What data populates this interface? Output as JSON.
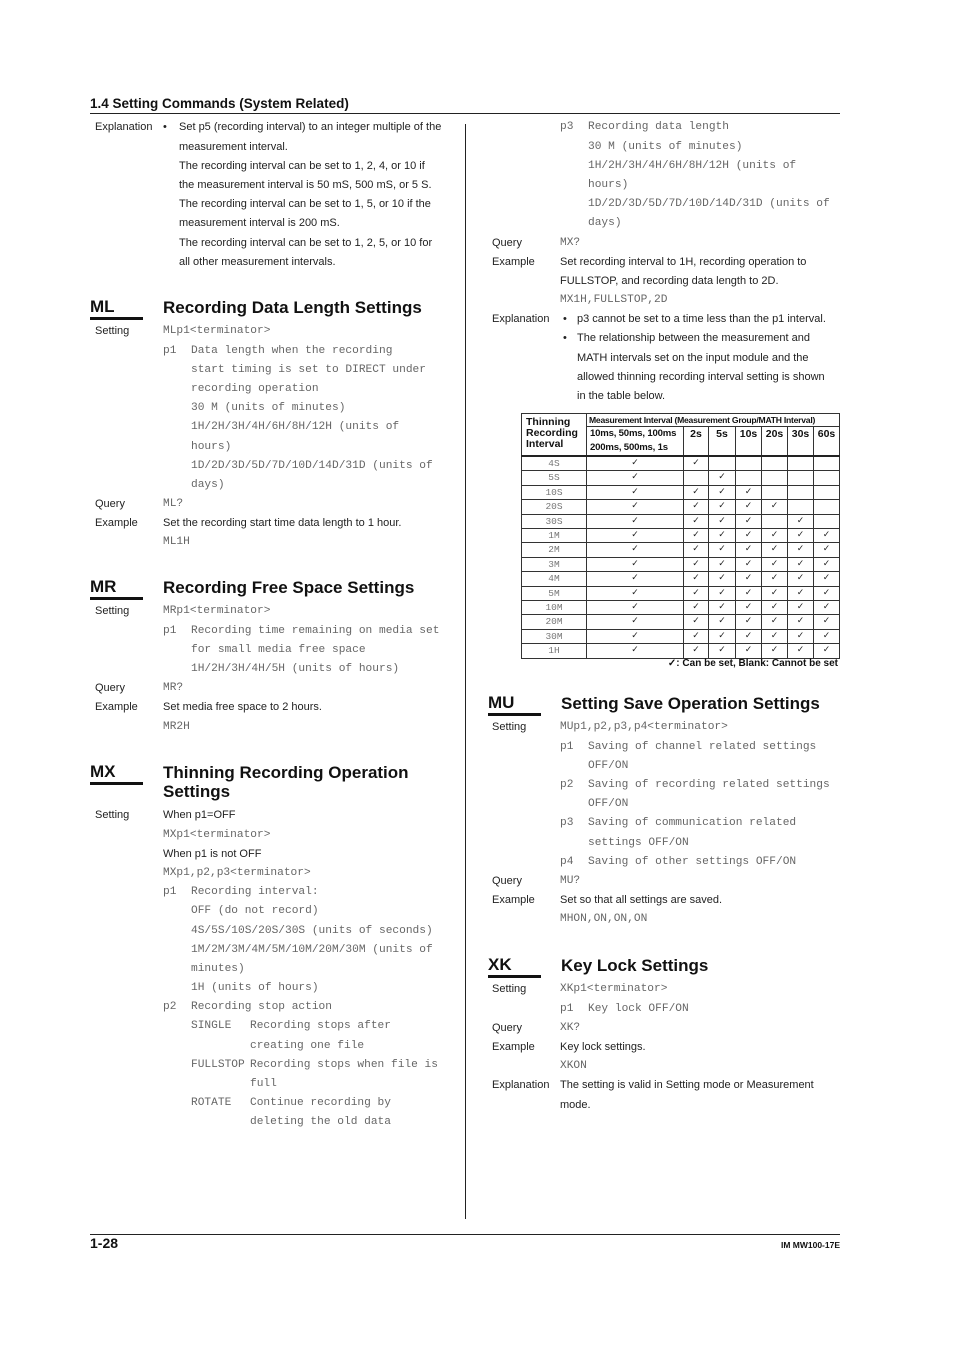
{
  "page_header": {
    "title": "1.4  Setting Commands (System Related)"
  },
  "intro_explanation": {
    "label": "Explanation",
    "bullet": "•",
    "lines": [
      "Set p5 (recording interval) to an integer multiple of the",
      "measurement interval.",
      "The recording interval can be set to 1, 2, 4, or 10 if",
      "the measurement interval is 50 mS, 500 mS, or 5 S.",
      "The recording interval can be set to 1, 5, or 10 if the",
      "measurement interval is 200 mS.",
      "The recording interval can be set to 1, 2, 5, or 10 for",
      "all other measurement intervals."
    ]
  },
  "ml": {
    "code": "ML",
    "title": "Recording Data Length Settings",
    "setting_label": "Setting",
    "syntax": "MLp1<terminator>",
    "p1": {
      "name": "p1",
      "lines": [
        "Data length when the recording",
        "start timing is set to DIRECT under",
        "recording operation",
        "30 M (units of minutes)",
        "1H/2H/3H/4H/6H/8H/12H (units of",
        "hours)",
        "1D/2D/3D/5D/7D/10D/14D/31D (units of",
        "days)"
      ]
    },
    "query_label": "Query",
    "query": "ML?",
    "example_label": "Example",
    "example_text": "Set the recording start time data length to 1 hour.",
    "example_code": "ML1H"
  },
  "mr": {
    "code": "MR",
    "title": "Recording Free Space Settings",
    "setting_label": "Setting",
    "syntax": "MRp1<terminator>",
    "p1": {
      "name": "p1",
      "lines": [
        "Recording time remaining on media set",
        "for small media free space",
        "1H/2H/3H/4H/5H (units of hours)"
      ]
    },
    "query_label": "Query",
    "query": "MR?",
    "example_label": "Example",
    "example_text": "Set media free space to 2 hours.",
    "example_code": "MR2H"
  },
  "mx": {
    "code": "MX",
    "title_lines": [
      "Thinning Recording Operation",
      "Settings"
    ],
    "setting_label": "Setting",
    "case_off_label": "When p1=OFF",
    "case_off_syntax": "MXp1<terminator>",
    "case_on_label": "When p1 is not OFF",
    "case_on_syntax": "MXp1,p2,p3<terminator>",
    "p1": {
      "name": "p1",
      "lines": [
        "Recording interval:",
        "OFF (do not record)",
        "4S/5S/10S/20S/30S (units of seconds)",
        "1M/2M/3M/4M/5M/10M/20M/30M (units of",
        "minutes)",
        "1H (units of hours)"
      ]
    },
    "p2": {
      "name": "p2",
      "title": "Recording stop action",
      "options": [
        {
          "name": "SINGLE",
          "lines": [
            "Recording stops after",
            "creating one file"
          ]
        },
        {
          "name": "FULLSTOP",
          "lines": [
            "Recording stops when file is",
            "full"
          ]
        },
        {
          "name": "ROTATE",
          "lines": [
            "Continue recording by",
            "deleting the old data"
          ]
        }
      ]
    },
    "p3": {
      "name": "p3",
      "lines": [
        "Recording data length",
        "30 M (units of minutes)",
        "1H/2H/3H/4H/6H/8H/12H (units of",
        "hours)",
        "1D/2D/3D/5D/7D/10D/14D/31D (units of",
        "days)"
      ]
    },
    "query_label": "Query",
    "query": "MX?",
    "example_label": "Example",
    "example_lines": [
      "Set recording interval to 1H, recording operation to",
      "FULLSTOP, and recording data length to 2D."
    ],
    "example_code": "MX1H,FULLSTOP,2D",
    "explanation_label": "Explanation",
    "bullet": "•",
    "explanation_bullets": [
      {
        "lines": [
          "p3 cannot be set to a time less than the p1 interval."
        ]
      },
      {
        "lines": [
          "The relationship between the measurement and",
          "MATH intervals set on the input module and the",
          "allowed thinning recording interval setting is shown",
          "in the table below."
        ]
      }
    ]
  },
  "thinning_table": {
    "row_header_lines": [
      "Thinning",
      "Recording",
      "Interval"
    ],
    "group_header": "Measurement Interval (Measurement Group/MATH Interval)",
    "columns": [
      {
        "lines": [
          "10ms, 50ms, 100ms",
          "200ms, 500ms, 1s"
        ]
      },
      {
        "lines": [
          "2s"
        ]
      },
      {
        "lines": [
          "5s"
        ]
      },
      {
        "lines": [
          "10s"
        ]
      },
      {
        "lines": [
          "20s"
        ]
      },
      {
        "lines": [
          "30s"
        ]
      },
      {
        "lines": [
          "60s"
        ]
      }
    ],
    "rows": [
      {
        "interval": "4S",
        "allowed": [
          true,
          true,
          false,
          false,
          false,
          false,
          false
        ]
      },
      {
        "interval": "5S",
        "allowed": [
          true,
          false,
          true,
          false,
          false,
          false,
          false
        ]
      },
      {
        "interval": "10S",
        "allowed": [
          true,
          true,
          true,
          true,
          false,
          false,
          false
        ]
      },
      {
        "interval": "20S",
        "allowed": [
          true,
          true,
          true,
          true,
          true,
          false,
          false
        ]
      },
      {
        "interval": "30S",
        "allowed": [
          true,
          true,
          true,
          true,
          false,
          true,
          false
        ]
      },
      {
        "interval": "1M",
        "allowed": [
          true,
          true,
          true,
          true,
          true,
          true,
          true
        ]
      },
      {
        "interval": "2M",
        "allowed": [
          true,
          true,
          true,
          true,
          true,
          true,
          true
        ]
      },
      {
        "interval": "3M",
        "allowed": [
          true,
          true,
          true,
          true,
          true,
          true,
          true
        ]
      },
      {
        "interval": "4M",
        "allowed": [
          true,
          true,
          true,
          true,
          true,
          true,
          true
        ]
      },
      {
        "interval": "5M",
        "allowed": [
          true,
          true,
          true,
          true,
          true,
          true,
          true
        ]
      },
      {
        "interval": "10M",
        "allowed": [
          true,
          true,
          true,
          true,
          true,
          true,
          true
        ]
      },
      {
        "interval": "20M",
        "allowed": [
          true,
          true,
          true,
          true,
          true,
          true,
          true
        ]
      },
      {
        "interval": "30M",
        "allowed": [
          true,
          true,
          true,
          true,
          true,
          true,
          true
        ]
      },
      {
        "interval": "1H",
        "allowed": [
          true,
          true,
          true,
          true,
          true,
          true,
          true
        ]
      }
    ],
    "check_symbol": "✓",
    "legend": "✓: Can be set, Blank: Cannot be set"
  },
  "mu": {
    "code": "MU",
    "title": "Setting Save Operation Settings",
    "setting_label": "Setting",
    "syntax": "MUp1,p2,p3,p4<terminator>",
    "params": [
      {
        "name": "p1",
        "lines": [
          "Saving of channel related settings",
          "OFF/ON"
        ]
      },
      {
        "name": "p2",
        "lines": [
          "Saving of recording related settings",
          "OFF/ON"
        ]
      },
      {
        "name": "p3",
        "lines": [
          "Saving of communication related",
          "settings OFF/ON"
        ]
      },
      {
        "name": "p4",
        "lines": [
          "Saving of other settings OFF/ON"
        ]
      }
    ],
    "query_label": "Query",
    "query": "MU?",
    "example_label": "Example",
    "example_text": "Set so that all settings are saved.",
    "example_code": "MHON,ON,ON,ON"
  },
  "xk": {
    "code": "XK",
    "title": "Key Lock Settings",
    "setting_label": "Setting",
    "syntax": "XKp1<terminator>",
    "p1": {
      "name": "p1",
      "lines": [
        "Key lock OFF/ON"
      ]
    },
    "query_label": "Query",
    "query": "XK?",
    "example_label": "Example",
    "example_text": "Key lock settings.",
    "example_code": "XKON",
    "explanation_label": "Explanation",
    "explanation_lines": [
      "The setting is valid in Setting mode or Measurement",
      "mode."
    ]
  },
  "footer": {
    "page_number": "1-28",
    "doc_id": "IM MW100-17E"
  }
}
